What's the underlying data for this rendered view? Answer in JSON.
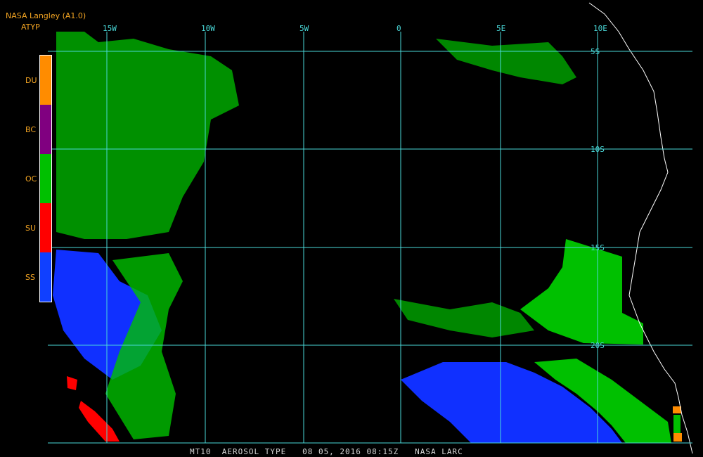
{
  "header": {
    "title": "NASA Langley (A1.0)",
    "product": "ATYP"
  },
  "legend": [
    {
      "code": "DU",
      "color": "#ff8c00"
    },
    {
      "code": "BC",
      "color": "#800080"
    },
    {
      "code": "OC",
      "color": "#00c000"
    },
    {
      "code": "SU",
      "color": "#ff0000"
    },
    {
      "code": "SS",
      "color": "#1040ff"
    }
  ],
  "grid": {
    "color": "#4ad9d9",
    "lon_labels": [
      "15W",
      "10W",
      "5W",
      "0",
      "5E",
      "10E"
    ],
    "lat_labels": [
      "5S",
      "10S",
      "15S",
      "20S"
    ]
  },
  "footer": {
    "text": "MT10  AEROSOL TYPE   08 05, 2016 08:15Z   NASA LARC"
  }
}
